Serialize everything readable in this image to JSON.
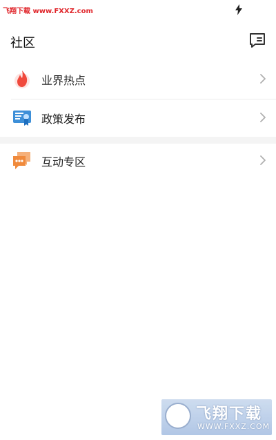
{
  "status_bar": {
    "watermark": "飞翔下载 www.FXXZ.com",
    "charging_icon": "lightning-icon"
  },
  "header": {
    "title": "社区",
    "message_icon": "message-icon"
  },
  "menu": [
    {
      "label": "业界热点",
      "icon": "flame-icon",
      "color": "#f0493c"
    },
    {
      "label": "政策发布",
      "icon": "certificate-icon",
      "color": "#3d8fd8"
    },
    {
      "label": "互动专区",
      "icon": "chat-bubbles-icon",
      "color": "#f08a3c"
    }
  ],
  "colors": {
    "watermark_red": "#e0262b",
    "chevron": "#b0b0b0",
    "section_gap": "#f4f4f4"
  },
  "watermark_logo": {
    "text": "飞翔下载",
    "url": "WWW.FXXZ.COM"
  }
}
